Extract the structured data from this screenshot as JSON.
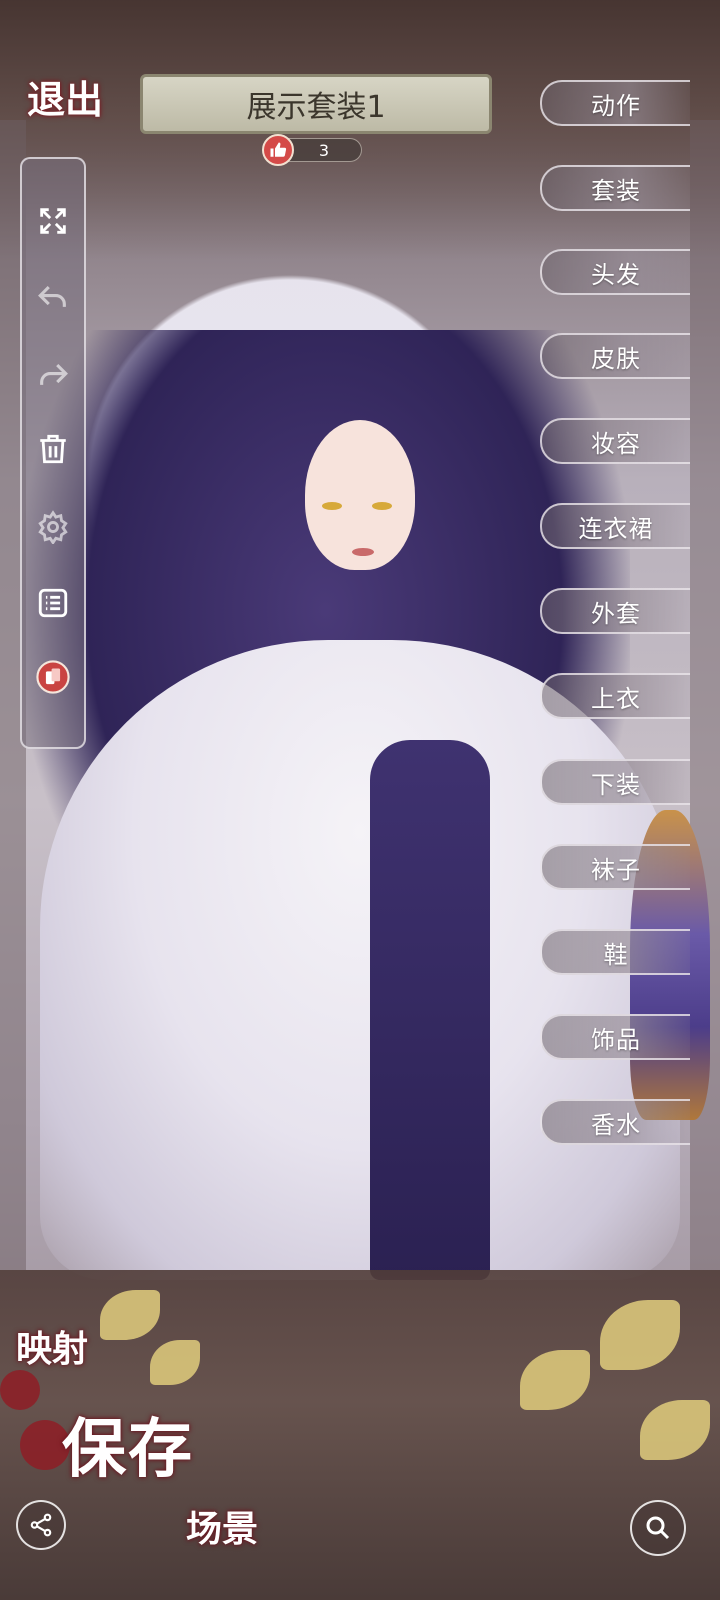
{
  "header": {
    "exit_label": "退出",
    "outfit_title": "展示套装1",
    "like_count": "3"
  },
  "toolbar": {
    "items": [
      {
        "icon": "fullscreen-icon"
      },
      {
        "icon": "undo-icon"
      },
      {
        "icon": "redo-icon"
      },
      {
        "icon": "trash-icon"
      },
      {
        "icon": "gear-icon"
      },
      {
        "icon": "list-icon"
      },
      {
        "icon": "card-swap-icon"
      }
    ]
  },
  "categories": [
    "动作",
    "套装",
    "头发",
    "皮肤",
    "妆容",
    "连衣裙",
    "外套",
    "上衣",
    "下装",
    "袜子",
    "鞋",
    "饰品",
    "香水"
  ],
  "bottom": {
    "mapping_label": "映射",
    "save_label": "保存",
    "scene_label": "场景"
  },
  "colors": {
    "accent_red": "#d44a48",
    "banner": "#d7d5c5"
  }
}
